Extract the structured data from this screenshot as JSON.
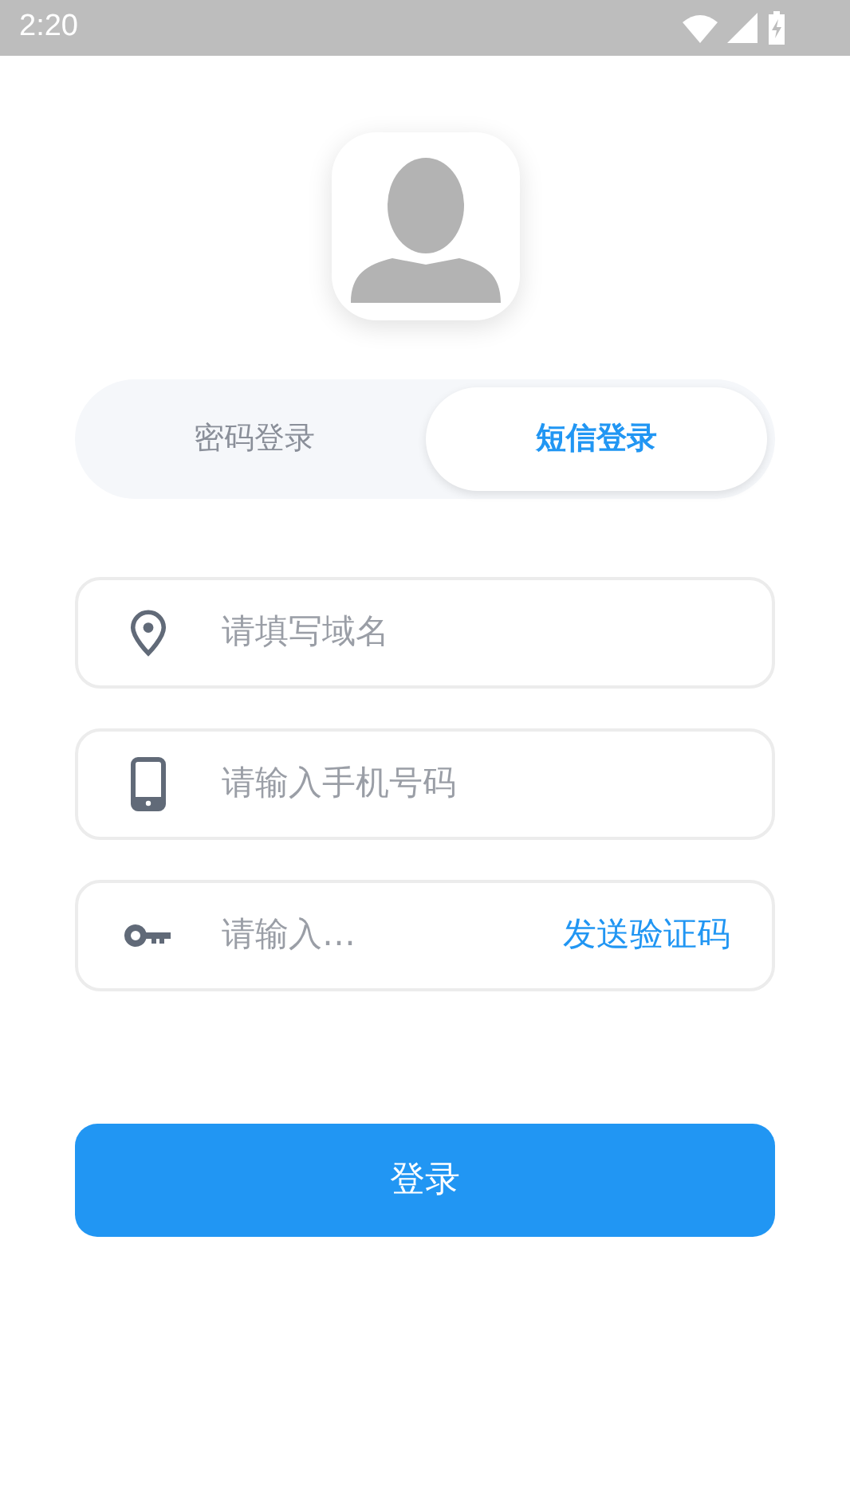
{
  "status_bar": {
    "time": "2:20"
  },
  "tabs": [
    {
      "label": "密码登录",
      "selected": false
    },
    {
      "label": "短信登录",
      "selected": true
    }
  ],
  "fields": [
    {
      "kind": "domain",
      "placeholder": "请填写域名"
    },
    {
      "kind": "phone",
      "placeholder": "请输入手机号码"
    },
    {
      "kind": "code",
      "placeholder": "请输入…",
      "action": "发送验证码"
    }
  ],
  "login_button": "登录"
}
